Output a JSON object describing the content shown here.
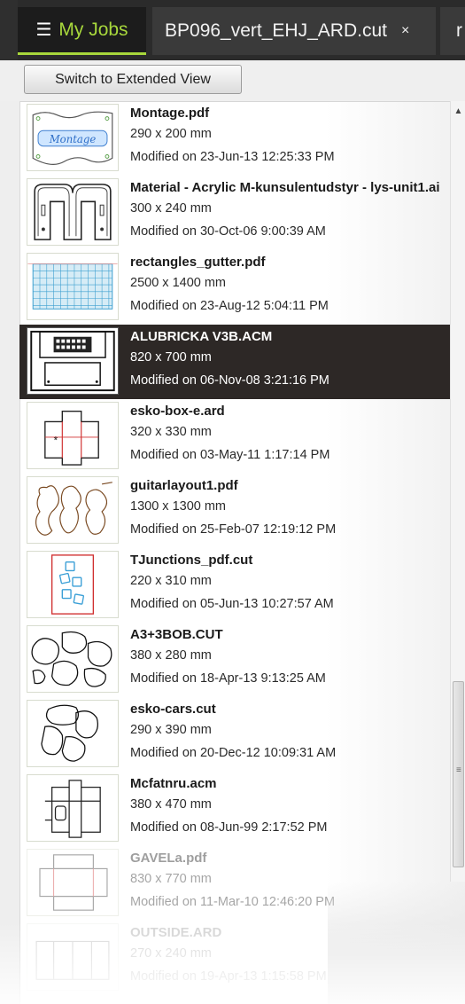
{
  "tabs": {
    "my_jobs": "My Jobs",
    "file_tab": "BP096_vert_EHJ_ARD.cut",
    "close_glyph": "×",
    "overflow_tab": "r"
  },
  "toolbar": {
    "switch_label": "Switch to Extended View"
  },
  "accent_color": "#a8d83c",
  "jobs": [
    {
      "name": "Montage.pdf",
      "size": "290 x 200 mm",
      "modified": "Modified on 23-Jun-13 12:25:33 PM",
      "thumb_text": "Montage"
    },
    {
      "name": "Material - Acrylic M-kunsulentudstyr - lys-unit1.ai",
      "size": "300 x 240 mm",
      "modified": "Modified on 30-Oct-06 9:00:39 AM"
    },
    {
      "name": "rectangles_gutter.pdf",
      "size": "2500 x 1400 mm",
      "modified": "Modified on 23-Aug-12 5:04:11 PM"
    },
    {
      "name": "ALUBRICKA V3B.ACM",
      "size": "820 x 700 mm",
      "modified": "Modified on 06-Nov-08 3:21:16 PM",
      "selected": true
    },
    {
      "name": "esko-box-e.ard",
      "size": "320 x 330 mm",
      "modified": "Modified on 03-May-11 1:17:14 PM"
    },
    {
      "name": "guitarlayout1.pdf",
      "size": "1300 x 1300 mm",
      "modified": "Modified on 25-Feb-07 12:19:12 PM"
    },
    {
      "name": "TJunctions_pdf.cut",
      "size": "220 x 310 mm",
      "modified": "Modified on 05-Jun-13 10:27:57 AM"
    },
    {
      "name": "A3+3BOB.CUT",
      "size": "380 x 280 mm",
      "modified": "Modified on 18-Apr-13 9:13:25 AM"
    },
    {
      "name": "esko-cars.cut",
      "size": "290 x 390 mm",
      "modified": "Modified on 20-Dec-12 10:09:31 AM"
    },
    {
      "name": "Mcfatnru.acm",
      "size": "380 x 470 mm",
      "modified": "Modified on 08-Jun-99 2:17:52 PM"
    },
    {
      "name": "GAVELa.pdf",
      "size": "830 x 770 mm",
      "modified": "Modified on 11-Mar-10 12:46:20 PM"
    },
    {
      "name": "OUTSIDE.ARD",
      "size": "270 x 240 mm",
      "modified": "Modified on 19-Apr-13 1:15:58 PM"
    }
  ]
}
